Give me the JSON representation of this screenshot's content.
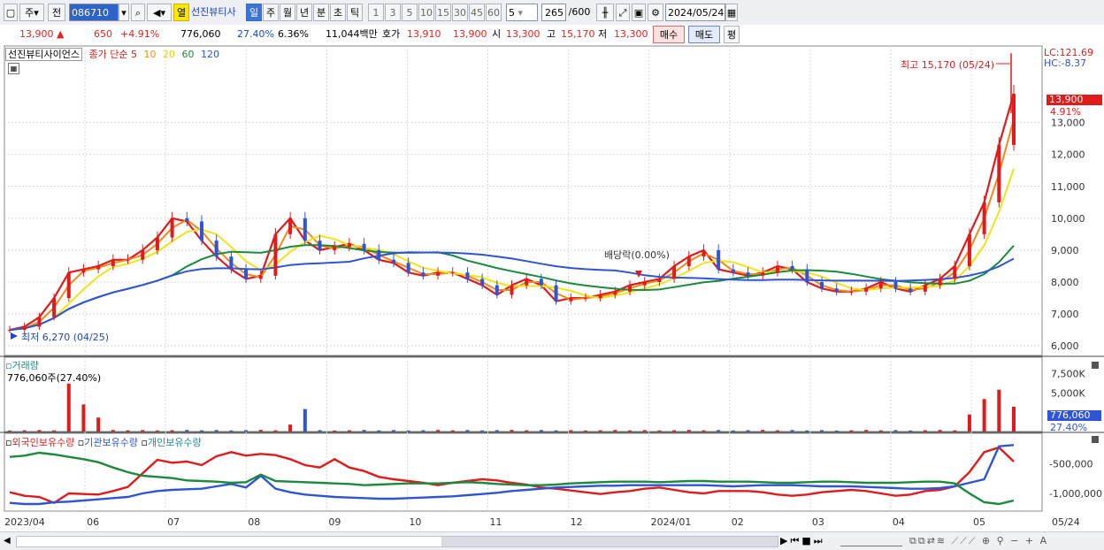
{
  "toolbar": {
    "type_label": "주",
    "cycle_label": "전",
    "code_value": "086710",
    "stock_name": "선진뷰티사",
    "highlight_label": "열",
    "period_tabs": [
      "일",
      "주",
      "월",
      "년",
      "분",
      "초",
      "틱"
    ],
    "active_tab": "일",
    "intervals": [
      "1",
      "3",
      "5",
      "10",
      "15",
      "30",
      "45",
      "60"
    ],
    "count_value": "5",
    "view_count": "265",
    "view_total": "/600",
    "date_value": "2024/05/24"
  },
  "quote": {
    "price": "13,900",
    "arrow": "▲",
    "change": "650",
    "change_pct": "+4.91%",
    "volume": "776,060",
    "vol_ratio": "27.40%",
    "turnover": "6.36%",
    "amount": "11,044백만",
    "bid_label": "호가",
    "bid": "13,910",
    "ask": "13,900",
    "open_label": "시",
    "open": "13,300",
    "high_label": "고",
    "high": "15,170",
    "low_label": "저",
    "low": "13,300",
    "buy_label": "매수",
    "sell_label": "매도",
    "eval_label": "평"
  },
  "chart_data": [
    {
      "type": "candlestick+line",
      "title": "선진뷰티사이언스",
      "legend": {
        "price": "종가 단순",
        "ma": [
          "5",
          "10",
          "20",
          "60",
          "120"
        ]
      },
      "ma_colors": {
        "5": "#e01b1b",
        "10": "#f08a1a",
        "20": "#f2e21a",
        "60": "#1b8a3c",
        "120": "#2f54d6"
      },
      "y_ticks": [
        13000,
        12000,
        11000,
        10000,
        9000,
        8000,
        7000,
        6000
      ],
      "ylim": [
        5700,
        15400
      ],
      "x_labels": [
        "2023/04",
        "06",
        "07",
        "08",
        "09",
        "10",
        "11",
        "12",
        "2024/01",
        "02",
        "03",
        "04",
        "05",
        "05/24"
      ],
      "annotations": {
        "high": "최고 15,170 (05/24)",
        "low": "최저 6,270 (04/25)",
        "dividend": "배당락(0.00%)",
        "lc": "LC:121.69",
        "hc": "HC:-8.37",
        "price_box": "13,900",
        "pct_box": "4.91%"
      },
      "close_series": [
        6500,
        6600,
        6900,
        7500,
        8300,
        8400,
        8500,
        8700,
        8700,
        9000,
        9400,
        10000,
        9900,
        9300,
        8800,
        8400,
        8100,
        8200,
        9500,
        10000,
        9300,
        9000,
        9100,
        9200,
        9000,
        8700,
        8600,
        8300,
        8200,
        8300,
        8300,
        8100,
        7900,
        7600,
        7900,
        8100,
        7900,
        7400,
        7500,
        7500,
        7600,
        7700,
        7900,
        8000,
        8100,
        8500,
        8800,
        9000,
        8400,
        8300,
        8200,
        8300,
        8500,
        8400,
        8000,
        7800,
        7700,
        7700,
        7800,
        8000,
        7800,
        7700,
        7900,
        8100,
        8500,
        9500,
        10500,
        12300,
        13900
      ]
    },
    {
      "type": "bar",
      "title": "거래량",
      "label": "776,060주(27.40%)",
      "y_ticks": [
        "7,500K",
        "5,000K"
      ],
      "value_box": "776,060",
      "pct_box": "27.40%"
    },
    {
      "type": "line",
      "series_names": [
        "외국인보유수량",
        "기관보유수량",
        "개인보유수량"
      ],
      "colors": [
        "#e01b1b",
        "#2f54d6",
        "#1b8a3c"
      ],
      "y_ticks": [
        "-500,000",
        "-1,000,000"
      ]
    }
  ]
}
